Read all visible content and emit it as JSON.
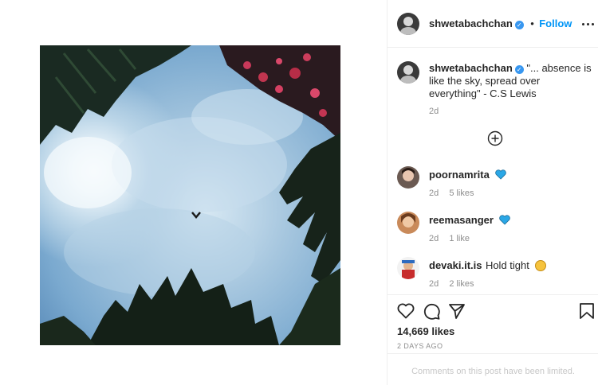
{
  "post": {
    "author": "shwetabachchan",
    "separator": "•",
    "follow_label": "Follow",
    "caption_user": "shwetabachchan",
    "caption_text": "\"... absence is like the sky, spread over everything\" - C.S Lewis",
    "caption_age": "2d",
    "likes": "14,669 likes",
    "date": "2 DAYS AGO",
    "comments_limited": "Comments on this post have been limited."
  },
  "comments": [
    {
      "user": "poornamrita",
      "text": "",
      "emoji": "blue-heart",
      "age": "2d",
      "likes": "5 likes"
    },
    {
      "user": "reemasanger",
      "text": "",
      "emoji": "blue-heart",
      "age": "2d",
      "likes": "1 like"
    },
    {
      "user": "devaki.it.is",
      "text": "Hold tight",
      "emoji": "hugging-face",
      "age": "2d",
      "likes": "2 likes"
    }
  ],
  "icons": {
    "more": "more-options-icon",
    "load_more": "plus-circle-icon",
    "like": "heart-outline-icon",
    "comment": "comment-bubble-icon",
    "share": "paper-plane-icon",
    "save": "bookmark-icon"
  },
  "colors": {
    "link": "#0095f6",
    "verified": "#3897f0",
    "emoji_heart": "#2aa7e6",
    "muted": "#8e8e8e",
    "limited_text": "#c7c7c7",
    "sky": "#7aa9cf"
  }
}
